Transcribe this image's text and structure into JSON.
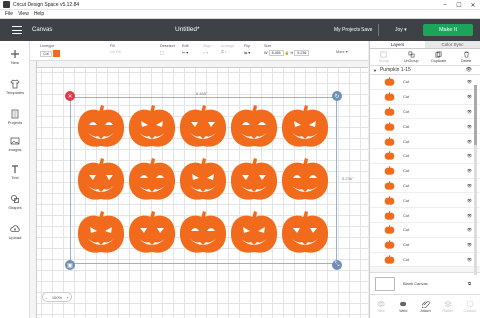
{
  "window": {
    "title": "Cricut Design Space  v5.12.84"
  },
  "menu": [
    "File",
    "View",
    "Help"
  ],
  "header": {
    "section": "Canvas",
    "project_title": "Untitled*",
    "my_projects": "My Projects",
    "save": "Save",
    "user": "Joy",
    "make_it": "Make It"
  },
  "toolbar": {
    "linetype_label": "Linetype",
    "linetype_value": "Cut",
    "fill_label": "Fill",
    "fill_value": "No Fill",
    "deselect_label": "Deselect",
    "edit_label": "Edit",
    "align_label": "Align",
    "arrange_label": "Arrange",
    "flip_label": "Flip",
    "size_label": "Size",
    "width_label": "W",
    "width_value": "8.465",
    "height_label": "H",
    "height_value": "5.236",
    "more_label": "More ▾",
    "fill_color": "#f26b1d"
  },
  "sidebar": {
    "items": [
      {
        "label": "New",
        "icon": "plus-icon"
      },
      {
        "label": "Templates",
        "icon": "shirt-icon"
      },
      {
        "label": "Projects",
        "icon": "projects-icon"
      },
      {
        "label": "Images",
        "icon": "images-icon"
      },
      {
        "label": "Text",
        "icon": "text-icon"
      },
      {
        "label": "Shapes",
        "icon": "shapes-icon"
      },
      {
        "label": "Upload",
        "icon": "upload-icon"
      }
    ]
  },
  "canvas": {
    "width_dim": "8.465\"",
    "height_dim": "5.236\"",
    "zoom": "100%",
    "pumpkin_color": "#f26b1d"
  },
  "layers_panel": {
    "tab_layers": "Layers",
    "tab_color_sync": "Color Sync",
    "actions": [
      "Group",
      "UnGroup",
      "Duplicate",
      "Delete"
    ],
    "group_name": "Pumpkin 1-15",
    "layer_items": [
      "Cut",
      "Cut",
      "Cut",
      "Cut",
      "Cut",
      "Cut",
      "Cut",
      "Cut",
      "Cut",
      "Cut",
      "Cut",
      "Cut",
      "Cut"
    ],
    "blank_canvas": "Blank Canvas",
    "bottom_actions": [
      "Slice",
      "Weld",
      "Attach",
      "Flatten",
      "Contour"
    ]
  }
}
